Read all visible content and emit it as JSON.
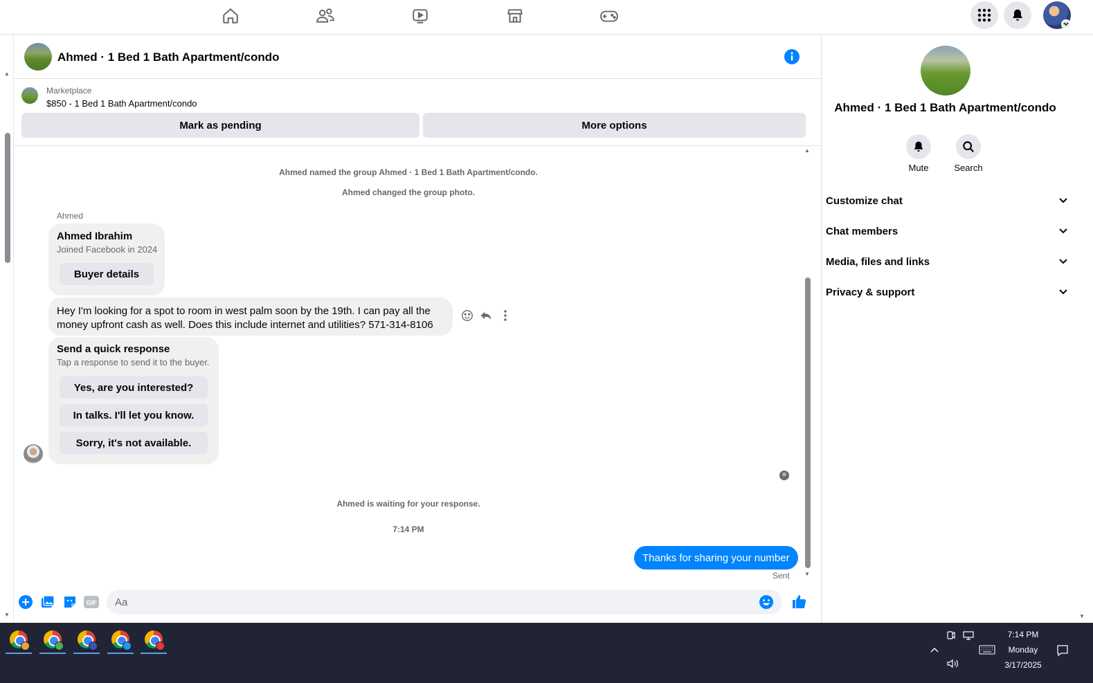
{
  "topnav": {
    "icons": [
      "home-icon",
      "friends-icon",
      "video-icon",
      "marketplace-icon",
      "gaming-icon"
    ],
    "right_icons": [
      "menu-grid-icon",
      "notifications-bell-icon",
      "account-avatar"
    ]
  },
  "chat": {
    "title": "Ahmed · 1 Bed 1 Bath Apartment/condo",
    "marketplace": {
      "label": "Marketplace",
      "item": "$850 - 1 Bed 1 Bath Apartment/condo",
      "mark_pending": "Mark as pending",
      "more_options": "More options"
    },
    "system_messages": {
      "named": "Ahmed named the group Ahmed · 1 Bed 1 Bath Apartment/condo.",
      "photo": "Ahmed changed the group photo.",
      "waiting": "Ahmed is waiting for your response.",
      "time": "7:14 PM"
    },
    "sender": "Ahmed",
    "buyer_card": {
      "name": "Ahmed Ibrahim",
      "joined": "Joined Facebook in 2024",
      "button": "Buyer details"
    },
    "message": "Hey I'm looking for a spot to room in west palm soon by the 19th. I can pay all the money upfront cash as well. Does this include internet and utilities? 571-314-8106",
    "quick_response": {
      "title": "Send a quick response",
      "subtitle": "Tap a response to send it to the buyer.",
      "options": [
        "Yes, are you interested?",
        "In talks. I'll let you know.",
        "Sorry, it's not available."
      ]
    },
    "outgoing": "Thanks for sharing your number",
    "status": "Sent",
    "composer": {
      "placeholder": "Aa"
    }
  },
  "right_panel": {
    "title": "Ahmed · 1 Bed 1 Bath Apartment/condo",
    "mute": "Mute",
    "search": "Search",
    "sections": [
      "Customize chat",
      "Chat members",
      "Media, files and links",
      "Privacy & support"
    ]
  },
  "taskbar": {
    "time": "7:14 PM",
    "day": "Monday",
    "date": "3/17/2025",
    "app_badges": [
      "#e8a040",
      "#4caf50",
      "#3f51b5",
      "#2196f3",
      "#e53935"
    ]
  },
  "colors": {
    "accent": "#0084ff",
    "brand": "#1877f2"
  }
}
